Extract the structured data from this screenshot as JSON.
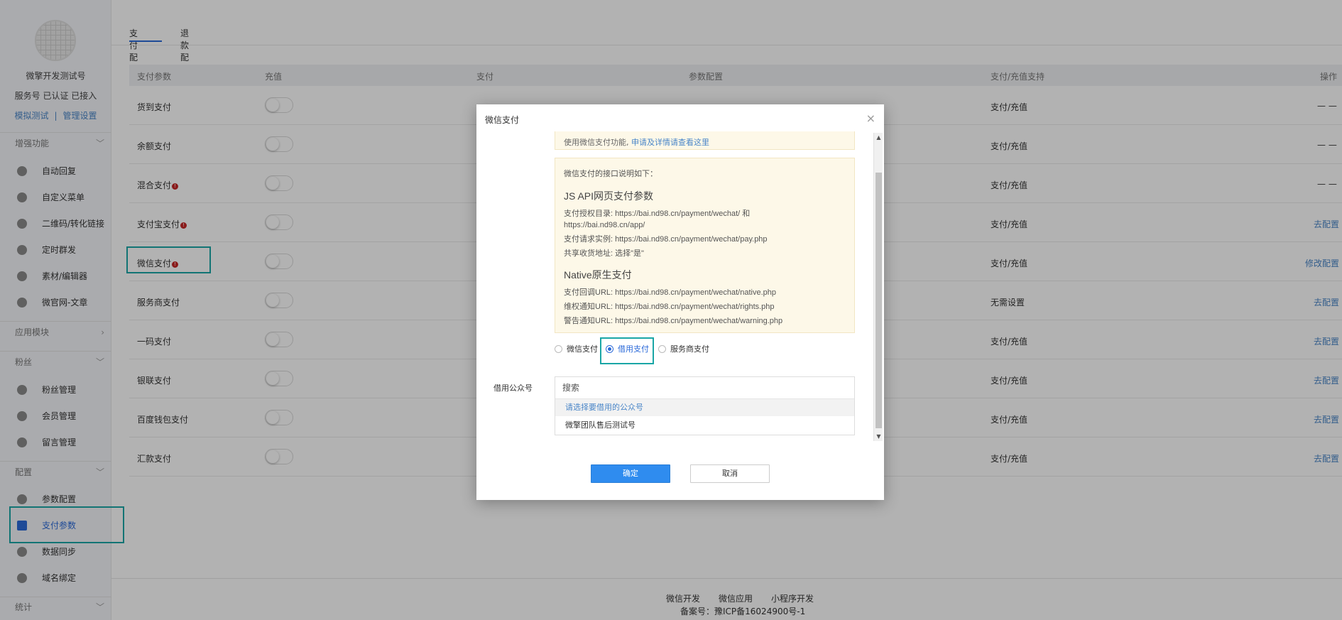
{
  "account": {
    "name": "微擎开发测试号",
    "type": "服务号 已认证 已接入",
    "link_test": "模拟测试",
    "link_sep": "|",
    "link_manage": "管理设置"
  },
  "sidebar": {
    "sections": [
      {
        "title": "增强功能",
        "chevron": "﹀"
      },
      {
        "title": "应用模块",
        "chevron": "›"
      },
      {
        "title": "粉丝",
        "chevron": "﹀"
      },
      {
        "title": "配置",
        "chevron": "﹀"
      },
      {
        "title": "统计",
        "chevron": "﹀"
      }
    ],
    "enhance_items": [
      {
        "label": "自动回复",
        "icon": "chat-icon"
      },
      {
        "label": "自定义菜单",
        "icon": "menu-edit-icon"
      },
      {
        "label": "二维码/转化链接",
        "icon": "qrcode-icon"
      },
      {
        "label": "定时群发",
        "icon": "clock-icon"
      },
      {
        "label": "素材/编辑器",
        "icon": "pencil-icon"
      },
      {
        "label": "微官网-文章",
        "icon": "home-icon"
      }
    ],
    "fans_items": [
      {
        "label": "粉丝管理",
        "icon": "heart-icon"
      },
      {
        "label": "会员管理",
        "icon": "heart-icon"
      },
      {
        "label": "留言管理",
        "icon": "mail-icon"
      }
    ],
    "config_items": [
      {
        "label": "参数配置",
        "icon": "list-icon"
      },
      {
        "label": "支付参数",
        "icon": "wallet-icon"
      },
      {
        "label": "数据同步",
        "icon": "sync-icon"
      },
      {
        "label": "域名绑定",
        "icon": "globe-icon"
      }
    ]
  },
  "tabs": [
    {
      "label": "支付配置",
      "active": true
    },
    {
      "label": "退款配置",
      "active": false
    }
  ],
  "table": {
    "headers": [
      "支付参数",
      "充值",
      "支付",
      "参数配置",
      "支付/充值支持",
      "操作"
    ],
    "rows": [
      {
        "name": "货到支付",
        "warn": false,
        "support": "支付/充值",
        "action": "— —"
      },
      {
        "name": "余额支付",
        "warn": false,
        "support": "支付/充值",
        "action": "— —"
      },
      {
        "name": "混合支付",
        "warn": true,
        "support": "支付/充值",
        "action": "— —"
      },
      {
        "name": "支付宝支付",
        "warn": true,
        "support": "支付/充值",
        "action": "去配置"
      },
      {
        "name": "微信支付",
        "warn": true,
        "support": "支付/充值",
        "action": "修改配置"
      },
      {
        "name": "服务商支付",
        "warn": false,
        "support": "无需设置",
        "action": "去配置"
      },
      {
        "name": "一码支付",
        "warn": false,
        "support": "支付/充值",
        "action": "去配置"
      },
      {
        "name": "银联支付",
        "warn": false,
        "support": "支付/充值",
        "action": "去配置"
      },
      {
        "name": "百度钱包支付",
        "warn": false,
        "support": "支付/充值",
        "action": "去配置"
      },
      {
        "name": "汇款支付",
        "warn": false,
        "support": "支付/充值",
        "action": "去配置"
      }
    ],
    "warn_glyph": "!"
  },
  "footer": {
    "links": [
      "微信开发",
      "微信应用",
      "小程序开发"
    ],
    "icp": "备案号：豫ICP备16024900号-1"
  },
  "modal": {
    "title": "微信支付",
    "close_glyph": "×",
    "notice_top_text": "使用微信支付功能,",
    "notice_top_link": "申请及详情请查看这里",
    "notice_intro": "微信支付的接口说明如下：",
    "jsapi_heading": "JS API网页支付参数",
    "jsapi_lines": [
      "支付授权目录: https://bai.nd98.cn/payment/wechat/ 和",
      "https://bai.nd98.cn/app/",
      "支付请求实例: https://bai.nd98.cn/payment/wechat/pay.php",
      "共享收货地址: 选择\"是\""
    ],
    "native_heading": "Native原生支付",
    "native_lines": [
      "支付回调URL: https://bai.nd98.cn/payment/wechat/native.php",
      "维权通知URL: https://bai.nd98.cn/payment/wechat/rights.php",
      "警告通知URL: https://bai.nd98.cn/payment/wechat/warning.php"
    ],
    "radio_options": [
      {
        "label": "微信支付",
        "checked": false
      },
      {
        "label": "借用支付",
        "checked": true
      },
      {
        "label": "服务商支付",
        "checked": false
      }
    ],
    "borrow_label": "借用公众号",
    "search_placeholder": "搜索",
    "select_placeholder": "请选择要借用的公众号",
    "select_options": [
      "微擎团队售后测试号"
    ],
    "ok_label": "确定",
    "cancel_label": "取消",
    "scroll_up": "▲",
    "scroll_down": "▼"
  },
  "colors": {
    "accent": "#2b6ad9",
    "highlight": "#1aa6a6",
    "primary_button": "#2f8cef",
    "notice_bg": "#fdf8e8"
  }
}
